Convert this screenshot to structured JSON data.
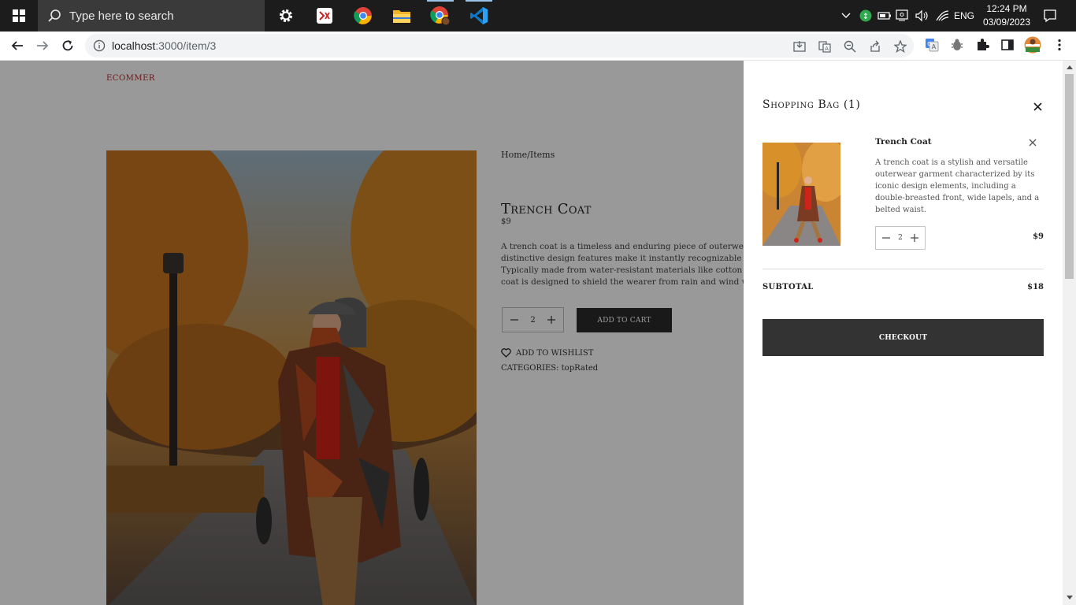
{
  "taskbar": {
    "search_placeholder": "Type here to search",
    "apps": [
      "settings-app",
      "testing-app",
      "chrome-app",
      "file-explorer-app",
      "chrome-profile-app",
      "vscode-app"
    ],
    "language": "ENG",
    "time": "12:24 PM",
    "date": "03/09/2023"
  },
  "browser": {
    "url_host": "localhost",
    "url_rest": ":3000/item/3"
  },
  "site": {
    "brand": "ECOMMER",
    "breadcrumb": "Home/Items",
    "product": {
      "title": "Trench Coat",
      "price": "$9",
      "description_lines": [
        "A trench coat is a timeless and enduring piece of outerwear t",
        "distinctive design features make it instantly recognizable an",
        "Typically made from water-resistant materials like cotton ga",
        "coat is designed to shield the wearer from rain and wind whi"
      ],
      "quantity": "2",
      "add_to_cart": "ADD TO CART",
      "wishlist": "ADD TO WISHLIST",
      "categories": "CATEGORIES: topRated"
    }
  },
  "cart": {
    "title": "Shopping Bag (1)",
    "item": {
      "name": "Trench Coat",
      "description": "A trench coat is a stylish and versatile outerwear garment characterized by its iconic design elements, including a double-breasted front, wide lapels, and a belted waist.",
      "quantity": "2",
      "price": "$9"
    },
    "subtotal_label": "SUBTOTAL",
    "subtotal_value": "$18",
    "checkout_label": "CHECKOUT"
  },
  "colors": {
    "brand": "#b3282e",
    "dark_button": "#2b2b2b",
    "checkout": "#333333",
    "overlay": "rgba(0,0,0,0.40)"
  }
}
